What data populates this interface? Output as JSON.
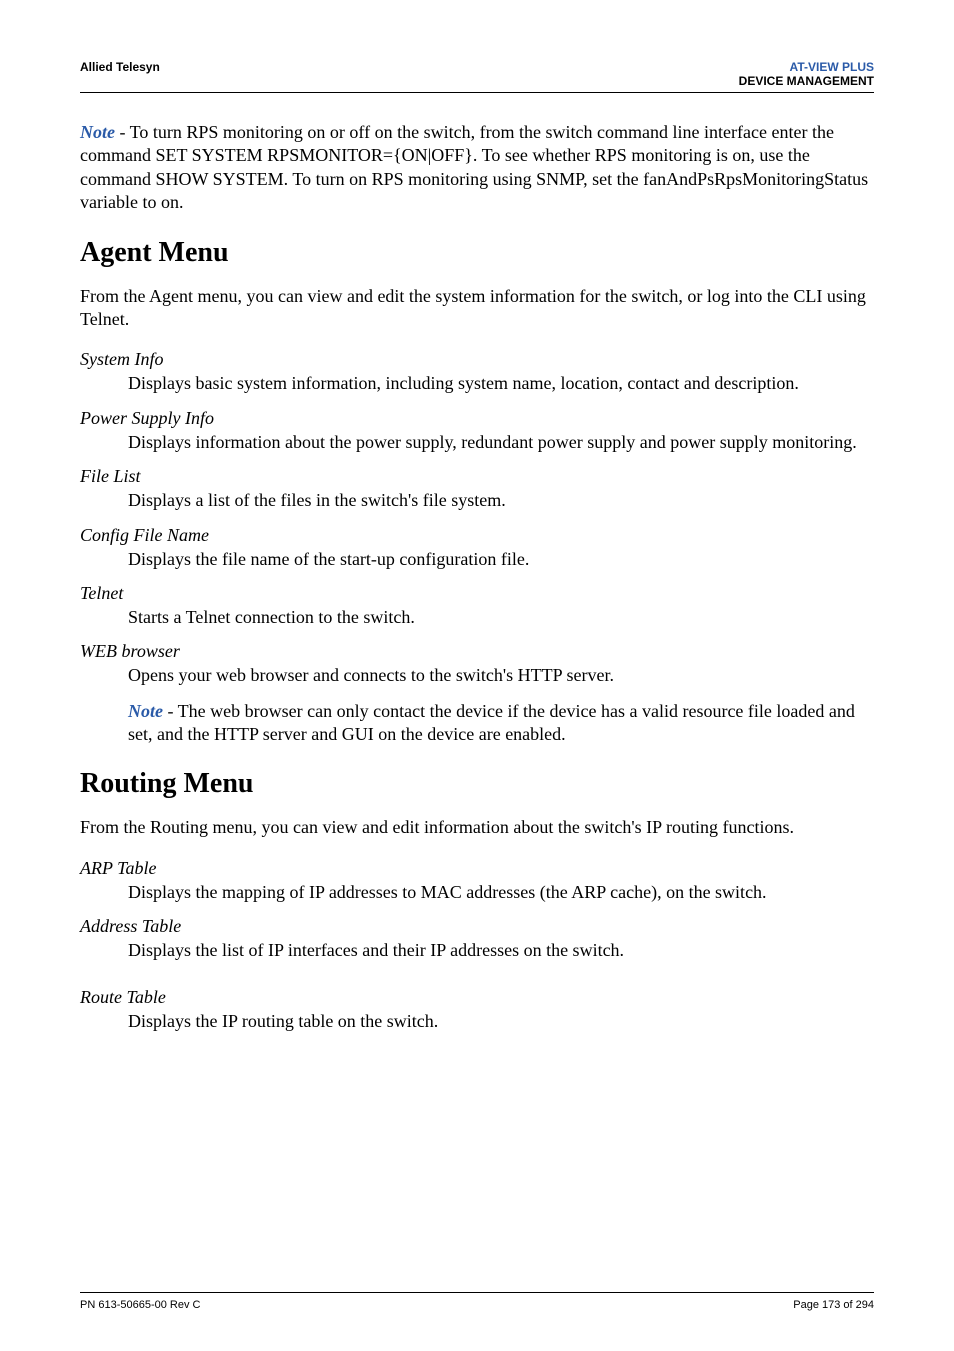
{
  "header": {
    "left": "Allied Telesyn",
    "right_line1": "AT-VIEW PLUS",
    "right_line2": "DEVICE MANAGEMENT"
  },
  "intro": {
    "note_label": "Note",
    "text": " - To turn RPS monitoring on or off on the switch, from the switch command line interface enter the command SET SYSTEM RPSMONITOR={ON|OFF}. To see whether RPS monitoring is on, use the command SHOW SYSTEM. To turn on RPS monitoring using SNMP, set the fanAndPsRpsMonitoringStatus variable to on."
  },
  "agent": {
    "heading": "Agent Menu",
    "lead": "From the Agent menu, you can view and edit the system information for the switch, or log into the CLI using Telnet.",
    "items": {
      "system_info": {
        "term": "System Info",
        "def": "Displays basic system information, including system name, location, contact and description."
      },
      "power_supply_info": {
        "term": "Power Supply Info",
        "def": "Displays information about the power supply, redundant power supply and power supply monitoring."
      },
      "file_list": {
        "term": "File List",
        "def": "Displays a list of the files in the switch's file system."
      },
      "config_file_name": {
        "term": "Config File Name",
        "def": "Displays the file name of the start-up configuration file."
      },
      "telnet": {
        "term": "Telnet",
        "def": "Starts a Telnet connection to the switch."
      },
      "web_browser": {
        "term": "WEB browser",
        "def": "Opens your web browser and connects to the switch's HTTP server.",
        "note_label": "Note",
        "note_text": " - The web browser can only contact the device if the device has a valid resource file loaded and set, and the HTTP server and GUI on the device are enabled."
      }
    }
  },
  "routing": {
    "heading": "Routing Menu",
    "lead": "From the Routing menu, you can view and edit information about the switch's IP routing functions.",
    "items": {
      "arp_table": {
        "term": "ARP Table",
        "def": "Displays the mapping of IP addresses to MAC addresses (the ARP cache), on the switch."
      },
      "address_table": {
        "term": "Address Table",
        "def": "Displays the list of IP interfaces and their IP addresses on the switch."
      },
      "route_table": {
        "term": "Route Table",
        "def": "Displays the IP routing table on the switch."
      }
    }
  },
  "footer": {
    "left": "PN 613-50665-00 Rev C",
    "right": "Page 173 of 294"
  }
}
